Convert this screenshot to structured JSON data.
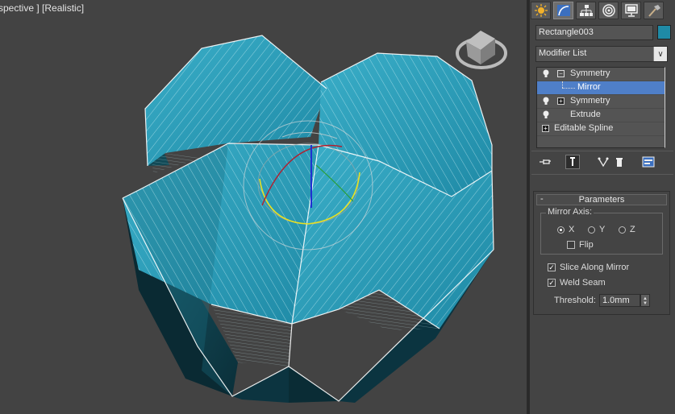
{
  "viewport": {
    "label": "spective ] [Realistic]"
  },
  "command_panel": {
    "tabs": [
      {
        "name": "create",
        "icon": "create-sun-icon"
      },
      {
        "name": "modify",
        "icon": "modify-curve-icon"
      },
      {
        "name": "hierarchy",
        "icon": "hierarchy-icon"
      },
      {
        "name": "motion",
        "icon": "motion-icon"
      },
      {
        "name": "display",
        "icon": "display-monitor-icon"
      },
      {
        "name": "utilities",
        "icon": "utilities-hammer-icon"
      }
    ],
    "active_tab": "modify",
    "object_name": "Rectangle003",
    "object_color": "#1f8aa6",
    "modifier_list_label": "Modifier List",
    "stack": [
      {
        "label": "Symmetry",
        "bulb": true,
        "box": "−",
        "indent": 0,
        "selected": false
      },
      {
        "label": "Mirror",
        "bulb": false,
        "box": "",
        "indent": 1,
        "selected": true
      },
      {
        "label": "Symmetry",
        "bulb": true,
        "box": "+",
        "indent": 0,
        "selected": false
      },
      {
        "label": "Extrude",
        "bulb": true,
        "box": "",
        "indent": 0,
        "selected": false
      },
      {
        "label": "Editable Spline",
        "bulb": false,
        "box": "+",
        "indent": -1,
        "selected": false
      }
    ],
    "stack_tools": [
      "pin-stack-icon",
      "show-end-result-icon",
      "make-unique-icon",
      "remove-modifier-icon",
      "configure-sets-icon"
    ]
  },
  "parameters": {
    "title": "Parameters",
    "collapse": "-",
    "mirror_axis_label": "Mirror Axis:",
    "axes": [
      "X",
      "Y",
      "Z"
    ],
    "selected_axis": "X",
    "flip_label": "Flip",
    "flip_checked": false,
    "slice_label": "Slice Along Mirror",
    "slice_checked": true,
    "weld_label": "Weld Seam",
    "weld_checked": true,
    "threshold_label": "Threshold:",
    "threshold_value": "1.0mm"
  },
  "colors": {
    "mesh_top": "#2a9cb8",
    "mesh_side": "#0f3f4c",
    "accent": "#4f7fc8"
  }
}
